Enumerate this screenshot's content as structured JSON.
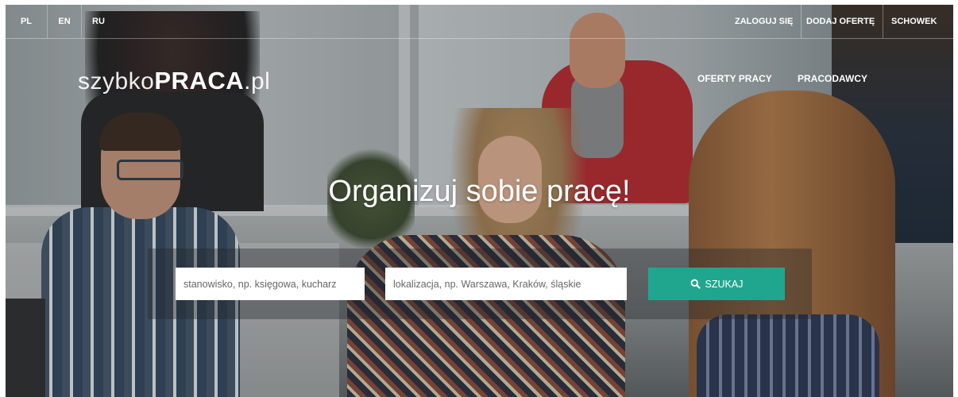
{
  "languages": {
    "pl": "PL",
    "en": "EN",
    "ru": "RU"
  },
  "top_links": {
    "login": "ZALOGUJ SIĘ",
    "add_offer": "DODAJ OFERTĘ",
    "clipboard": "SCHOWEK"
  },
  "logo": {
    "part1": "szybko",
    "part2": "PRACA",
    "part3": ".pl"
  },
  "main_nav": {
    "offers": "OFERTY PRACY",
    "employers": "PRACODAWCY"
  },
  "headline": "Organizuj sobie pracę!",
  "search": {
    "position_placeholder": "stanowisko, np. księgowa, kucharz",
    "location_placeholder": "lokalizacja, np. Warszawa, Kraków, śląskie",
    "button_label": "SZUKAJ",
    "button_color": "#20a68e",
    "button_icon": "search-icon"
  }
}
